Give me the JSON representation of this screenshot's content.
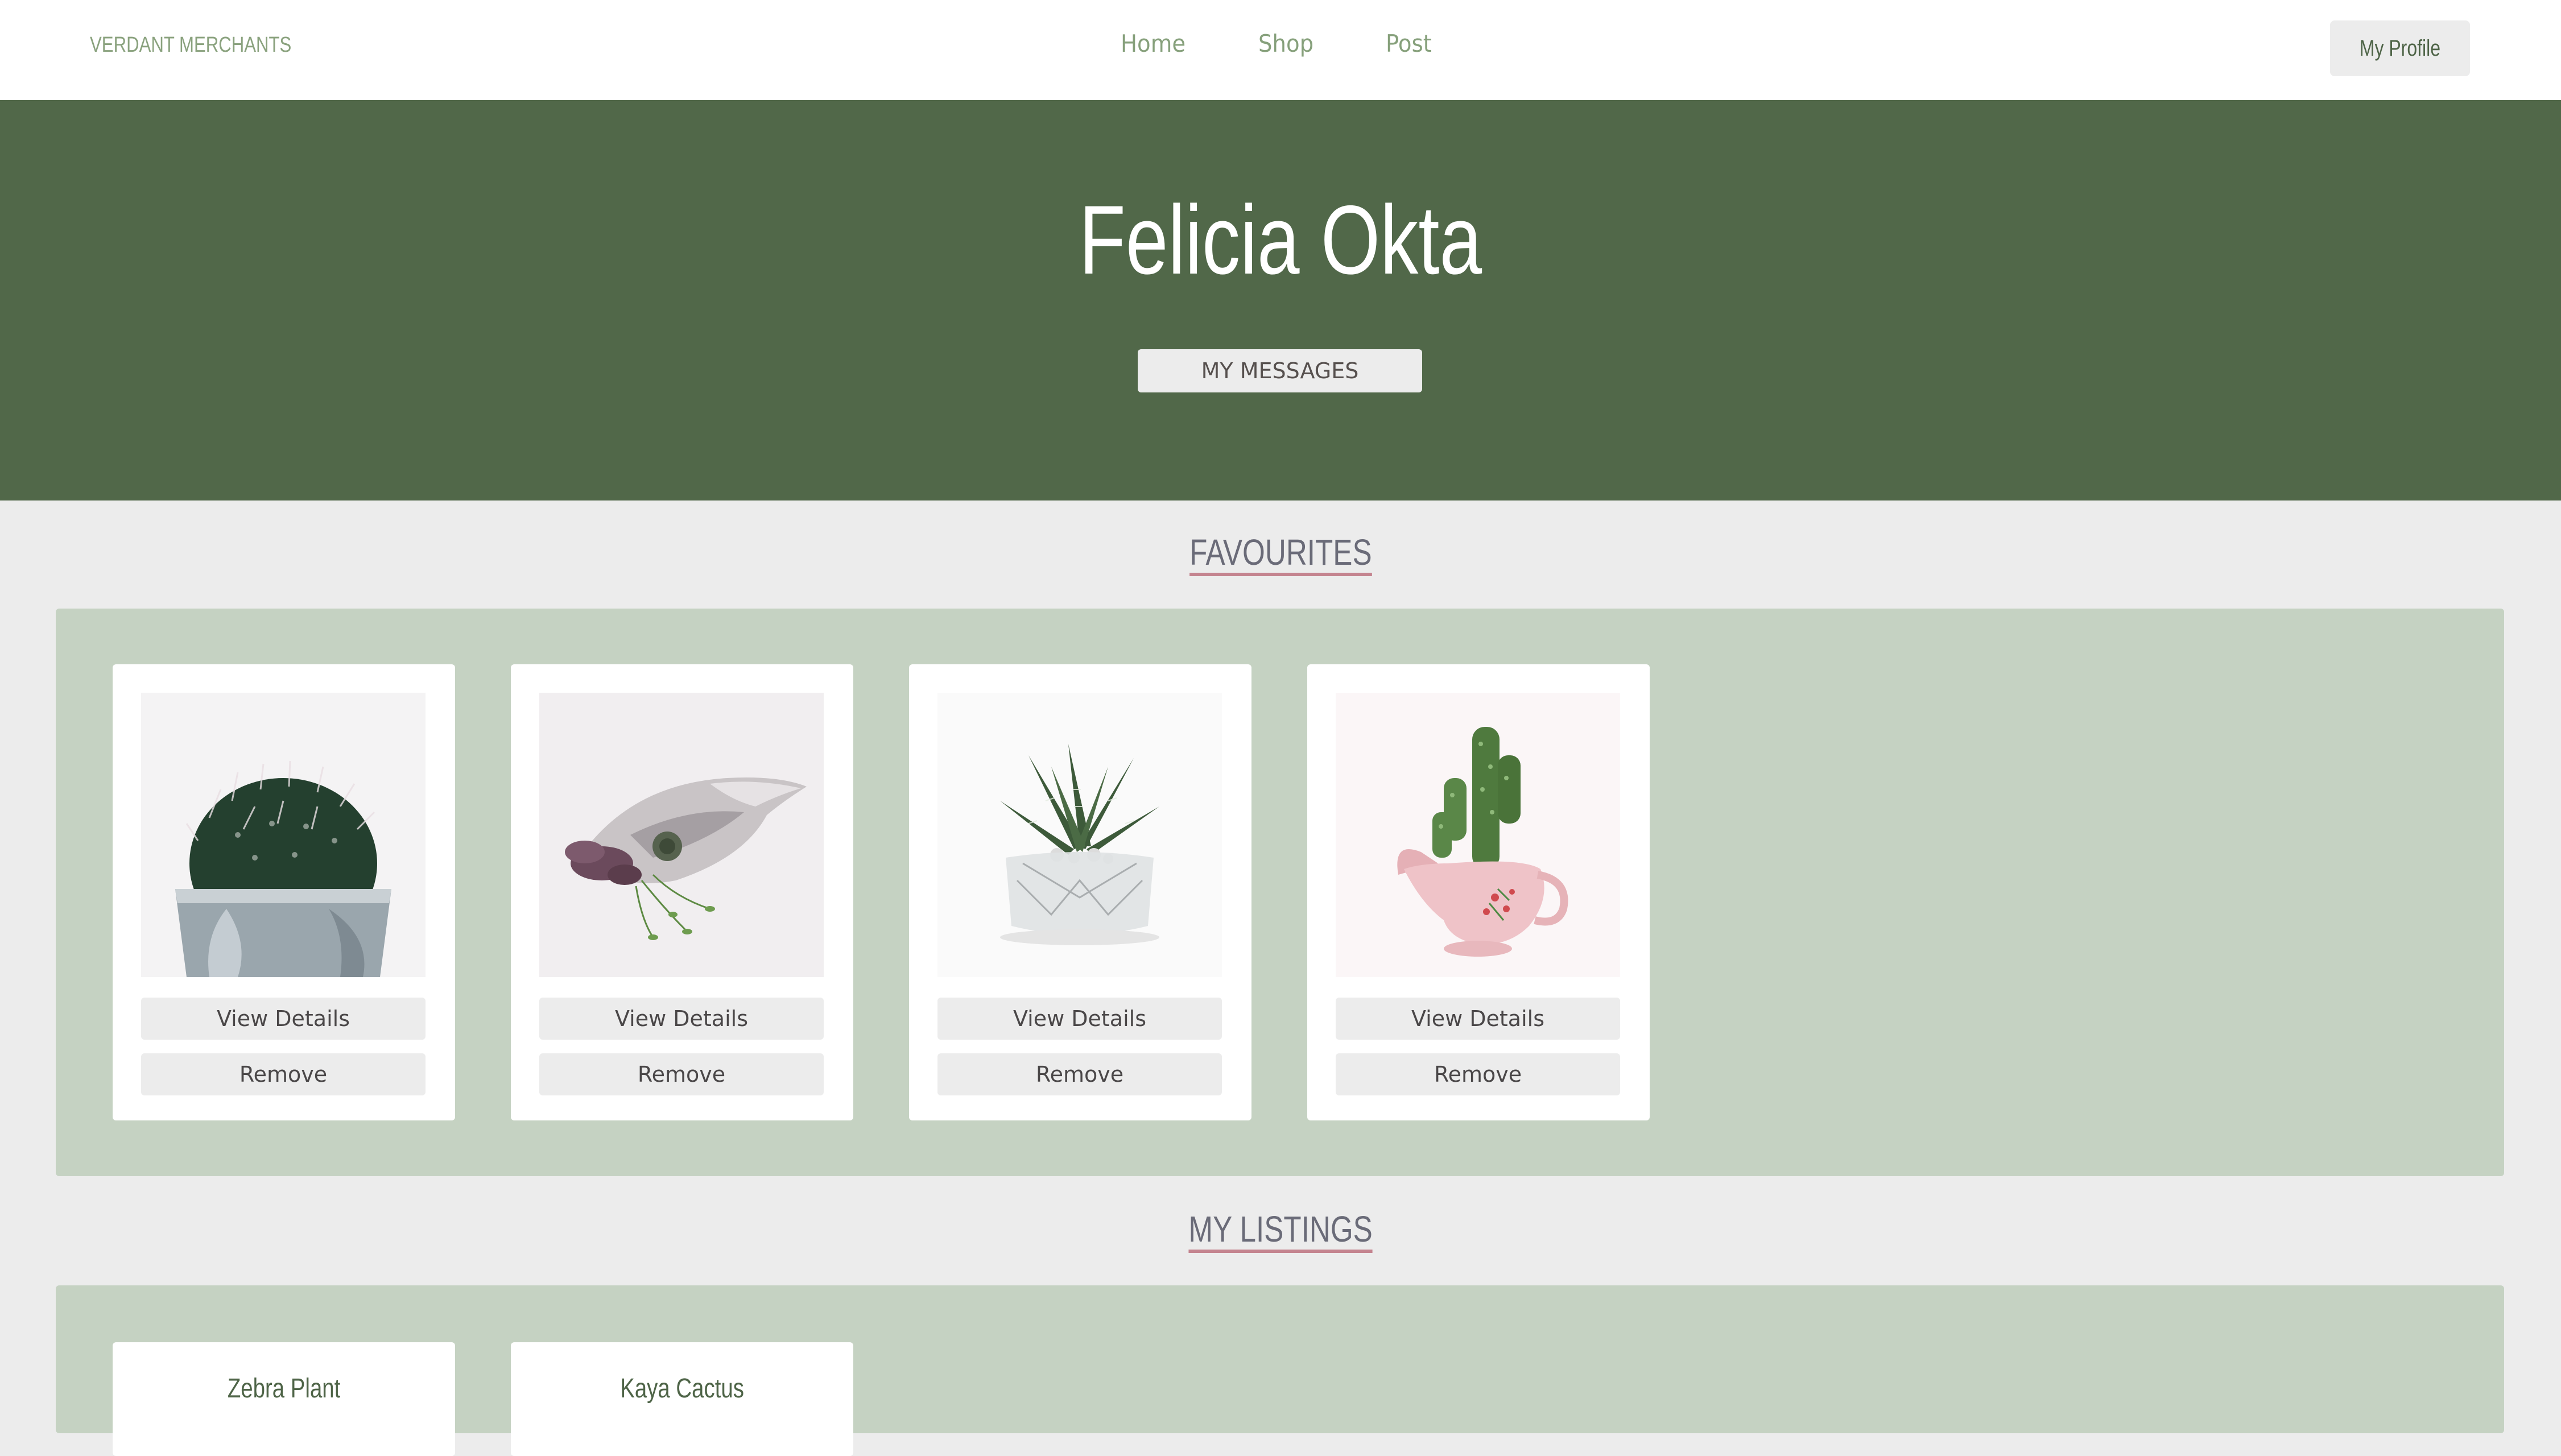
{
  "navbar": {
    "brand": "VERDANT MERCHANTS",
    "links": [
      "Home",
      "Shop",
      "Post"
    ],
    "profile_button": "My Profile"
  },
  "hero": {
    "name": "Felicia Okta",
    "messages_button": "MY MESSAGES"
  },
  "favourites": {
    "title": "FAVOURITES",
    "items": [
      {
        "image": "cactus-in-silver-pot-image",
        "view_label": "View Details",
        "remove_label": "Remove"
      },
      {
        "image": "succulents-in-seashell-image",
        "view_label": "View Details",
        "remove_label": "Remove"
      },
      {
        "image": "zebra-plant-in-crystal-bowl-image",
        "view_label": "View Details",
        "remove_label": "Remove"
      },
      {
        "image": "cactus-in-pink-pitcher-image",
        "view_label": "View Details",
        "remove_label": "Remove"
      }
    ]
  },
  "listings": {
    "title": "MY LISTINGS",
    "items": [
      {
        "name": "Zebra Plant"
      },
      {
        "name": "Kaya Cactus"
      }
    ]
  },
  "colors": {
    "hero_bg": "#516849",
    "panel_bg": "#c5d2c2",
    "accent_underline": "#c4848f",
    "brand_green": "#8aa27e"
  }
}
